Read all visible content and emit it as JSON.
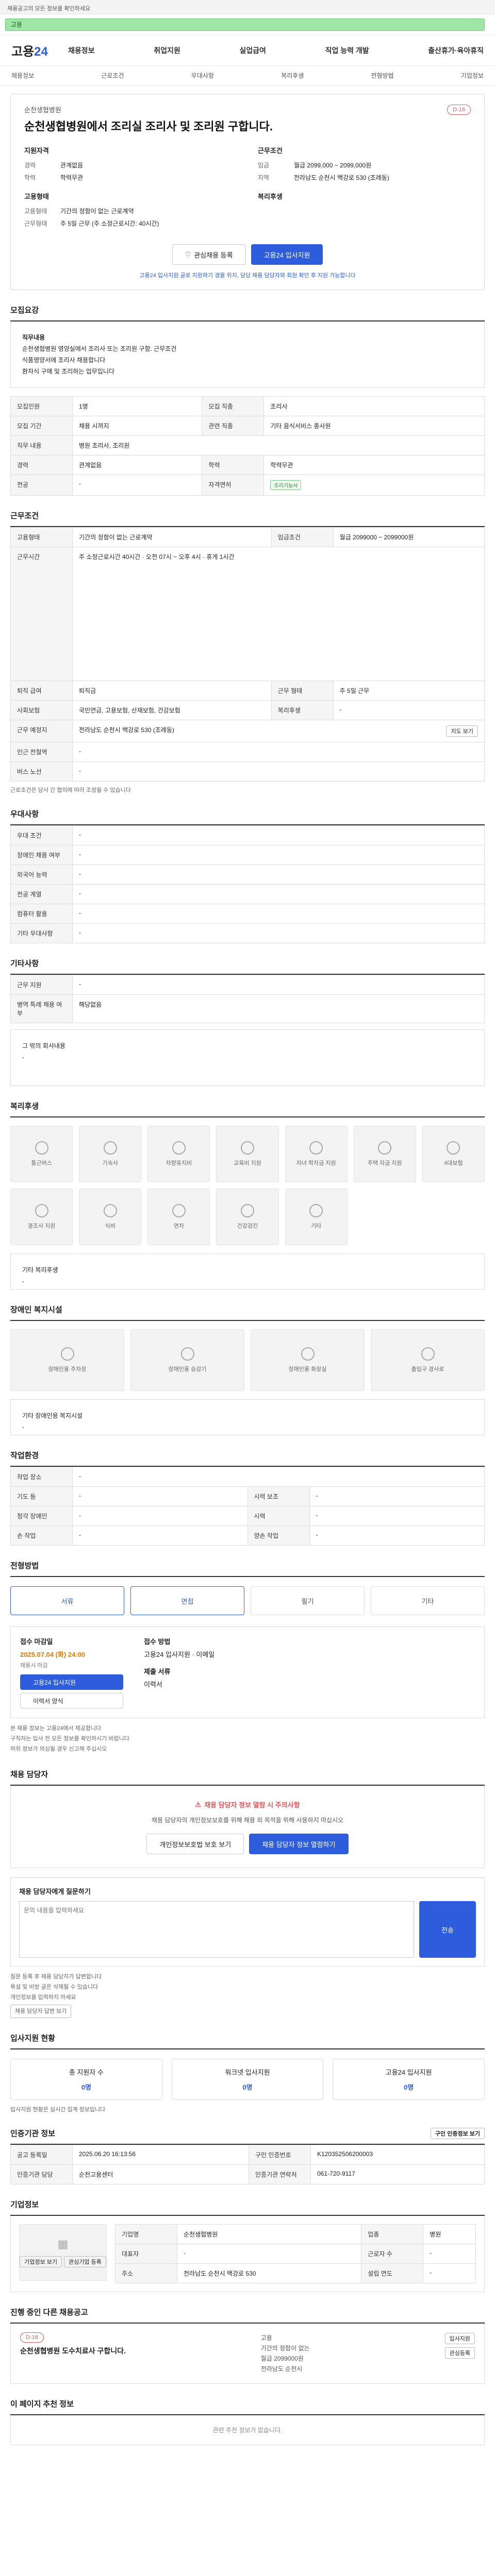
{
  "top": {
    "notice": "채용공고의 모든 정보를 확인하세요",
    "banner": "고용"
  },
  "nav": {
    "logo_a": "고용",
    "logo_b": "24",
    "menu": [
      "채용정보",
      "취업지원",
      "실업급여",
      "직업 능력 개발",
      "출산휴가·육아휴직"
    ]
  },
  "subnav": [
    "채용정보",
    "근로조건",
    "우대사항",
    "복리후생",
    "전형방법",
    "기업정보"
  ],
  "job": {
    "company": "순천생협병원",
    "title": "순천생협병원에서 조리실 조리사 및 조리원 구합니다.",
    "dday": "D-16",
    "left_h": "지원자격",
    "left": [
      {
        "k": "경력",
        "v": "관계없음"
      },
      {
        "k": "학력",
        "v": "학력무관"
      }
    ],
    "right_h": "근무조건",
    "right": [
      {
        "k": "임금",
        "v": "월급 2099,000 ~ 2099,000원"
      },
      {
        "k": "지역",
        "v": "전라남도 순천시 백강로 530 (조례동)"
      }
    ],
    "left2_h": "고용형태",
    "left2": [
      {
        "k": "고용형태",
        "v": "기간의 정함이 없는 근로계약"
      },
      {
        "k": "근무형태",
        "v": "주 5일 근무 (주 소정근로시간: 40시간)"
      }
    ],
    "right2_h": "복리후생",
    "save_btn": "관심채용 등록",
    "apply_btn": "고용24 입사지원",
    "apply_note": "고용24 입사지원 글로 지원하기 경을 위치, 담당 채용 담당자와 회원 확인 후 지원 가능합니다"
  },
  "sections": {
    "recruit": "모집요강",
    "conditions": "근무조건",
    "preference": "우대사항",
    "etc": "기타사항",
    "welfare": "복리후생",
    "disabled": "장애인 복지시설",
    "workenv": "작업환경",
    "process": "전형방법",
    "manager": "채용 담당자",
    "status": "입사지원 현황",
    "company": "기업정보",
    "other": "인증기관 정보",
    "related": "진행 중인 다른 채용공고",
    "recommend": "이 페이지 추천 정보"
  },
  "recruit_detail": [
    "직무내용",
    "순천생협병원 영양실에서 조리사 또는 조리원 구함. 근무조건",
    "식품영양서에 조리사 채용합니다",
    "환자식 구매 및 조리하는 업무입니다"
  ],
  "recruit_table": [
    {
      "k": "모집인원",
      "v": "1명",
      "k2": "모집 직종",
      "v2": "조리사"
    },
    {
      "k": "모집 기간",
      "v": "채용 시까지",
      "k2": "관련 직종",
      "v2": "기타 음식서비스 종사원"
    },
    {
      "k": "직무 내용",
      "v": "병원 조리사, 조리원",
      "k2": "",
      "v2": ""
    },
    {
      "k": "경력",
      "v": "관계없음",
      "k2": "학력",
      "v2": "학력무관"
    },
    {
      "k": "전공",
      "v": "-",
      "k2": "자격면허",
      "v2": "조리기능사"
    }
  ],
  "cond_table": [
    {
      "k": "고용형태",
      "v": "기간의 정함이 없는 근로계약",
      "k2": "임금조건",
      "v2": "월급 2099000 ~ 2099000원"
    },
    {
      "k": "근무시간",
      "v": "주 소정근로시간 40시간 · 오전 07시 ~ 오후 4시 · 휴게 1시간"
    },
    {
      "k": "퇴직 급여",
      "v": "퇴직금",
      "k2": "근무 형태",
      "v2": "주 5일 근무"
    },
    {
      "k": "사회보험",
      "v": "국민연금, 고용보험, 산재보험, 건강보험",
      "k2": "복리후생",
      "v2": "-"
    },
    {
      "k": "근무 예정지",
      "v": "전라남도 순천시 백강로 530 (조례동)",
      "k2": "",
      "v2": ""
    },
    {
      "k": "인근 전철역",
      "v": "-",
      "k2": "",
      "v2": ""
    },
    {
      "k": "버스 노선",
      "v": "-",
      "k2": "",
      "v2": ""
    }
  ],
  "map_btn": "지도 보기",
  "cond_note": "근로조건은 당사 간 협의에 따라 조정될 수 있습니다",
  "pref_table": [
    {
      "k": "우대 조건",
      "v": "-"
    },
    {
      "k": "장애인 채용 여부",
      "v": "-"
    },
    {
      "k": "외국어 능력",
      "v": "-"
    },
    {
      "k": "전공 계열",
      "v": "-"
    },
    {
      "k": "컴퓨터 활용",
      "v": "-"
    },
    {
      "k": "기타 우대사항",
      "v": "-"
    }
  ],
  "etc_table": [
    {
      "k": "근무 지원",
      "v": "-"
    },
    {
      "k": "병역 특례 채용 여부",
      "v": "해당없음"
    }
  ],
  "etc_detail": [
    "그 밖의 회사내용",
    "-"
  ],
  "welfare_icons": [
    "통근버스",
    "기숙사",
    "차량유지비",
    "교육비 지원",
    "자녀 학자금 지원",
    "주택 자금 지원",
    "4대보험",
    "경조사 지원",
    "식비",
    "연차",
    "건강검진",
    "기타"
  ],
  "welfare_other": [
    "기타 복리후생",
    "-"
  ],
  "disabled_icons": [
    "장애인용 주차장",
    "장애인용 승강기",
    "장애인용 화장실",
    "출입구 경사로"
  ],
  "disabled_other": [
    "기타 장애인용 복지시설",
    "-"
  ],
  "workenv_table": [
    {
      "k": "작업 장소",
      "v": "-"
    },
    {
      "k": "기도 등",
      "v": "-",
      "k2": "시력 보조",
      "v2": "-"
    },
    {
      "k": "청각 장애인",
      "v": "-",
      "k2": "시력",
      "v2": "-"
    },
    {
      "k": "손 작업",
      "v": "-",
      "k2": "양손 작업",
      "v2": "-"
    }
  ],
  "steps": [
    "서류",
    "면접",
    "필기",
    "기타"
  ],
  "deadline_h": "접수 마감일",
  "deadline": "2025.07.04 (화) 24:00",
  "deadline_sub": "채용시 마감",
  "apply_method_h": "접수 방법",
  "apply_method": "고용24 입사지원 · 이메일",
  "docs_h": "제출 서류",
  "docs": "이력서",
  "apply_btn2": "고용24 입사지원",
  "print_btn": "이력서 양식",
  "process_notes": [
    "본 채용 정보는 고용24에서 제공합니다",
    "구직자는 입사 전 모든 정보를 확인하시기 바랍니다",
    "허위 정보가 의심될 경우 신고해 주십시오"
  ],
  "manager_warn": "채용 담당자 정보 열람 시 주의사항",
  "manager_text": "채용 담당자의 개인정보보호를 위해 채용 외 목적을 위해 사용하지 마십시오",
  "manager_btn1": "개인정보보호법 보호 보기",
  "manager_btn2": "채용 담당자 정보 열람하기",
  "inquiry_h": "채용 담당자에게 질문하기",
  "inquiry_ph": "문의 내용을 입력하세요",
  "inquiry_btn": "전송",
  "inquiry_notes": [
    "질문 등록 후 채용 담당자가 답변합니다",
    "욕설 및 비방 글은 삭제될 수 있습니다",
    "개인정보를 입력하지 마세요"
  ],
  "inquiry_link": "채용 담당자 답변 보기",
  "status_boxes": [
    {
      "label": "총 지원자 수",
      "val": "0명"
    },
    {
      "label": "워크넷 입사지원",
      "val": "0명"
    },
    {
      "label": "고용24 입사지원",
      "val": "0명"
    }
  ],
  "status_note": "입사지원 현황은 실시간 집계 정보입니다",
  "other_table": [
    {
      "k": "공고 등록일",
      "v": "2025.06.20 16:13:56",
      "k2": "구인 인증번호",
      "v2": "K120352506200003"
    },
    {
      "k": "인증기관 담당",
      "v": "순천고용센터",
      "k2": "인증기관 연락처",
      "v2": "061-720-9117"
    }
  ],
  "other_btn": "구인 인증정보 보기",
  "company_table": [
    {
      "k": "기업명",
      "v": "순천생협병원",
      "k2": "업종",
      "v2": "병원"
    },
    {
      "k": "대표자",
      "v": "-",
      "k2": "근로자 수",
      "v2": "-"
    },
    {
      "k": "주소",
      "v": "전라남도 순천시 백강로 530",
      "k2": "설립 연도",
      "v2": "-"
    }
  ],
  "company_btns": [
    "기업정보 보기",
    "관심기업 등록"
  ],
  "related_h": "D-16",
  "related_title": "순천생협병원 도수치료사 구합니다.",
  "related_meta": [
    "고용",
    "기간의 정함이 없는",
    "월급 2099000원",
    "전라남도 순천시"
  ],
  "related_btns": [
    "입사지원",
    "관심등록"
  ],
  "recommend_text": "관련 추천 정보가 없습니다."
}
